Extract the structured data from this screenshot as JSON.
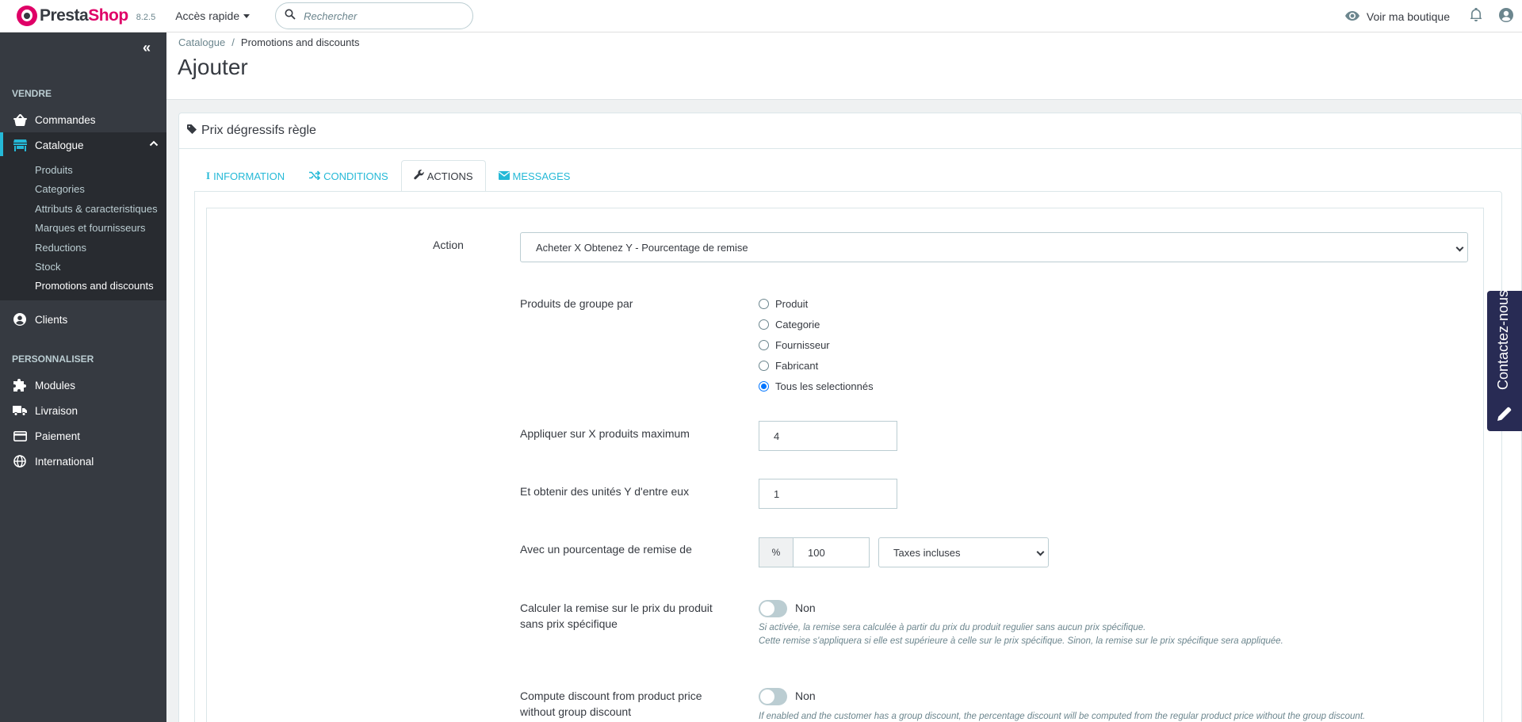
{
  "header": {
    "logo_text_a": "Presta",
    "logo_text_b": "Shop",
    "version": "8.2.5",
    "quick_access": "Accès rapide",
    "search_placeholder": "Rechercher",
    "view_shop": "Voir ma boutique"
  },
  "sidebar": {
    "section_sell": "VENDRE",
    "orders": "Commandes",
    "catalog": "Catalogue",
    "catalog_items": [
      "Produits",
      "Categories",
      "Attributs & caracteristiques",
      "Marques et fournisseurs",
      "Reductions",
      "Stock",
      "Promotions and discounts"
    ],
    "customers": "Clients",
    "section_customize": "PERSONNALISER",
    "modules": "Modules",
    "shipping": "Livraison",
    "payment": "Paiement",
    "international": "International"
  },
  "breadcrumb": {
    "parent": "Catalogue",
    "sep": "/",
    "current": "Promotions and discounts"
  },
  "page_title": "Ajouter",
  "panel": {
    "title": "Prix dégressifs règle",
    "tabs": [
      "INFORMATION",
      "CONDITIONS",
      "ACTIONS",
      "MESSAGES"
    ]
  },
  "form": {
    "action_label": "Action",
    "action_value": "Acheter X Obtenez Y - Pourcentage de remise",
    "group_label": "Produits de groupe par",
    "group_options": [
      "Produit",
      "Categorie",
      "Fournisseur",
      "Fabricant",
      "Tous les selectionnés"
    ],
    "group_selected": "Tous les selectionnés",
    "max_label": "Appliquer sur X produits maximum",
    "max_value": "4",
    "units_label": "Et obtenir des unités Y d'entre eux",
    "units_value": "1",
    "pct_label": "Avec un pourcentage de remise de",
    "pct_addon": "%",
    "pct_value": "100",
    "tax_value": "Taxes incluses",
    "calc_label_1": "Calculer la remise sur le prix du produit",
    "calc_label_2": "sans prix spécifique",
    "calc_toggle": "Non",
    "calc_help_1": "Si activée, la remise sera calculée à partir du prix du produit regulier sans aucun prix spécifique.",
    "calc_help_2": "Cette remise s'appliquera si elle est supérieure à celle sur le prix spécifique. Sinon, la remise sur le prix spécifique sera appliquée.",
    "group_disc_label_1": "Compute discount from product price",
    "group_disc_label_2": "without group discount",
    "group_disc_toggle": "Non",
    "group_disc_help": "If enabled and the customer has a group discount, the percentage discount will be computed from the regular product price without the group discount."
  },
  "contact_tab": "Contactez-nous",
  "colors": {
    "brand": "#df0067",
    "accent": "#25b9d7",
    "sidebar": "#363a41"
  }
}
